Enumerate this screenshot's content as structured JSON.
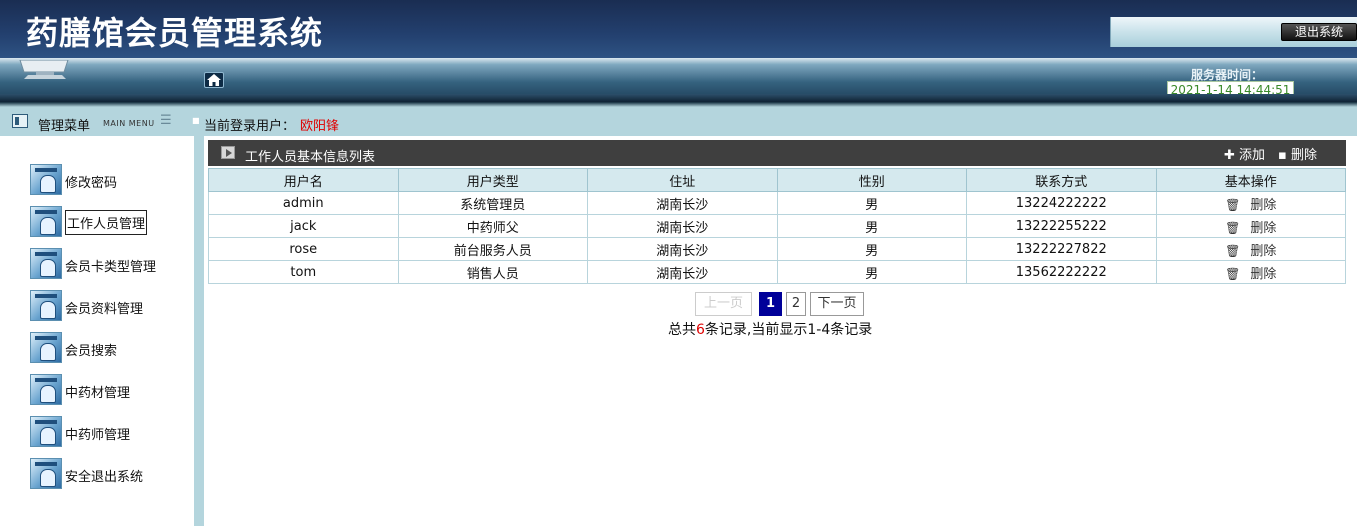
{
  "header": {
    "app_title": "药膳馆会员管理系统",
    "logout_label": "退出系统"
  },
  "navbar": {
    "home_icon": "home-icon",
    "server_time_label": "服务器时间：",
    "server_time_value": "2021-1-14 14:44:51"
  },
  "subbar": {
    "menu_title": "管理菜单",
    "menu_title_en": "MAIN MENU",
    "login_label": "当前登录用户：",
    "login_user": "欧阳锋"
  },
  "sidebar": {
    "items": [
      {
        "label": "修改密码"
      },
      {
        "label": "工作人员管理"
      },
      {
        "label": "会员卡类型管理"
      },
      {
        "label": "会员资料管理"
      },
      {
        "label": "会员搜索"
      },
      {
        "label": "中药材管理"
      },
      {
        "label": "中药师管理"
      },
      {
        "label": "安全退出系统"
      }
    ],
    "active_index": 1
  },
  "panel": {
    "title": "工作人员基本信息列表",
    "add_label": "✚ 添加",
    "delete_label": "▪ 删除"
  },
  "table": {
    "headers": [
      "用户名",
      "用户类型",
      "住址",
      "性别",
      "联系方式",
      "基本操作"
    ],
    "rows": [
      {
        "username": "admin",
        "type": "系统管理员",
        "address": "湖南长沙",
        "gender": "男",
        "phone": "13224222222",
        "op": "删除"
      },
      {
        "username": "jack",
        "type": "中药师父",
        "address": "湖南长沙",
        "gender": "男",
        "phone": "13222255222",
        "op": "删除"
      },
      {
        "username": "rose",
        "type": "前台服务人员",
        "address": "湖南长沙",
        "gender": "男",
        "phone": "13222227822",
        "op": "删除"
      },
      {
        "username": "tom",
        "type": "销售人员",
        "address": "湖南长沙",
        "gender": "男",
        "phone": "13562222222",
        "op": "删除"
      }
    ]
  },
  "pager": {
    "prev": "上一页",
    "page1": "1",
    "page2": "2",
    "next": "下一页",
    "summary_prefix": "总共",
    "total": "6",
    "summary_suffix": "条记录,当前显示1-4条记录"
  },
  "colors": {
    "accent_red": "#e00000",
    "active_page": "#000099",
    "header_bg": "#1a2d52"
  }
}
